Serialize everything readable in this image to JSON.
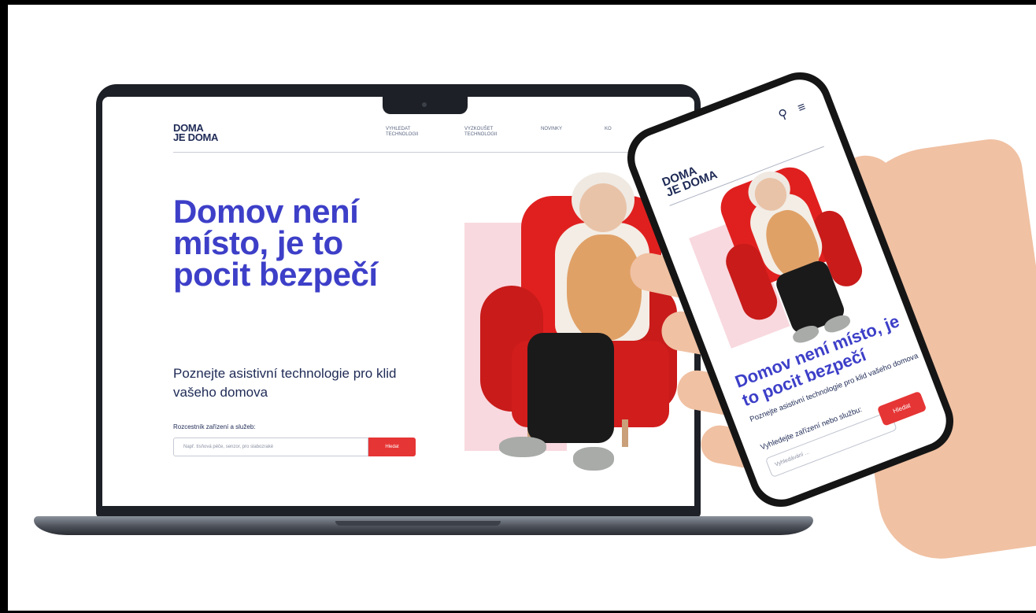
{
  "site": {
    "logo_line1": "DOMA",
    "logo_line2": "JE DOMA"
  },
  "desktop": {
    "nav": [
      {
        "label": "VYHLEDAT TECHNOLOGII"
      },
      {
        "label": "VYZKOUŠET TECHNOLOGII"
      },
      {
        "label": "NOVINKY"
      },
      {
        "label": "KO"
      }
    ],
    "headline": "Domov není místo, je to pocit bezpečí",
    "subheadline": "Poznejte asistivní technologie pro klid vašeho domova",
    "search_label": "Rozcestník zařízení a služeb:",
    "search_placeholder": "Např. tísňová péče, senzor, pro slabozraké",
    "search_button": "Hledat"
  },
  "mobile": {
    "headline": "Domov není místo, je to pocit bezpečí",
    "subheadline": "Poznejte asistivní technologie pro klid vašeho domova",
    "search_label": "Vyhledejte zařízení nebo službu:",
    "search_placeholder": "Vyhledávání ...",
    "search_button": "Hledat"
  },
  "colors": {
    "accent_blue": "#3d3fc8",
    "brand_navy": "#1e2a55",
    "button_red": "#e63535",
    "chair_red": "#e0201f",
    "pink_bg": "#f8d9df"
  },
  "icons": {
    "search": "search-icon",
    "menu": "hamburger-menu-icon"
  }
}
